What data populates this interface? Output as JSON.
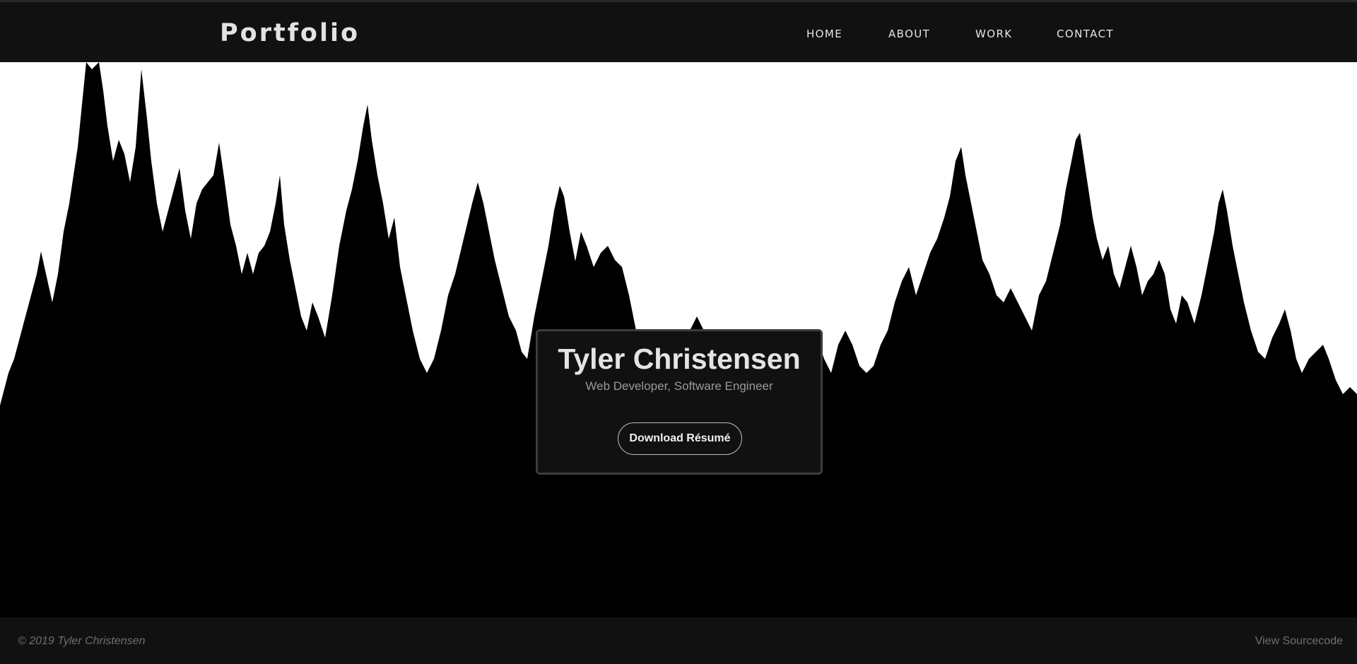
{
  "header": {
    "brand": "Portfolio",
    "nav": [
      {
        "label": "HOME"
      },
      {
        "label": "ABOUT"
      },
      {
        "label": "WORK"
      },
      {
        "label": "CONTACT"
      }
    ]
  },
  "hero": {
    "background_image": "forest-silhouette",
    "name": "Tyler Christensen",
    "subtitle": "Web Developer, Software Engineer",
    "button_label": "Download Résumé"
  },
  "footer": {
    "copyright": "© 2019 Tyler Christensen",
    "source_link": "View Sourcecode"
  },
  "colors": {
    "navbar_bg": "#111111",
    "sky": "#ffffff",
    "silhouette": "#000000",
    "card_bg": "#111111",
    "card_border": "#3d3d3d",
    "text_light": "#e4e4e4",
    "text_muted": "#6f6f6f"
  }
}
